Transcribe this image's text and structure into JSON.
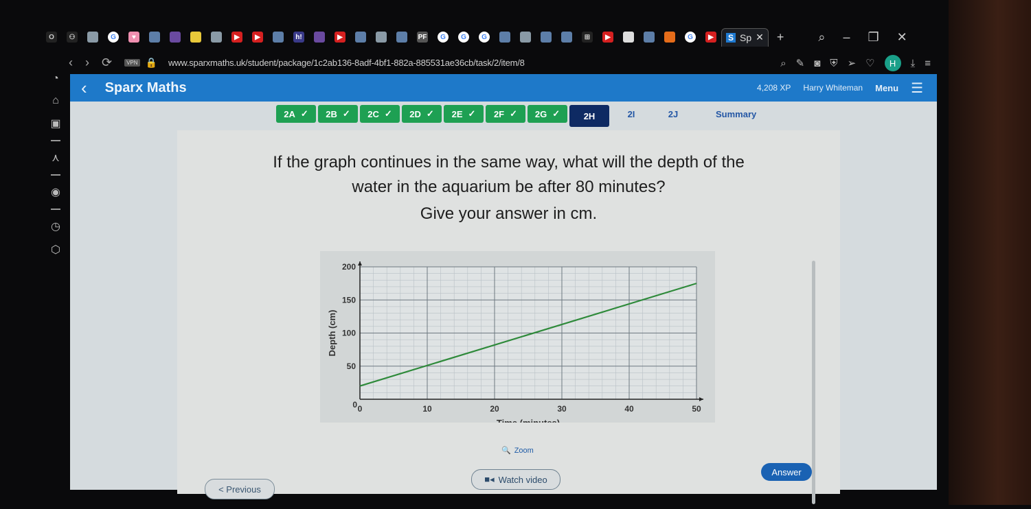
{
  "browser": {
    "tab_title": "Sp",
    "tab_badge": "S",
    "url": "www.sparxmaths.uk/student/package/1c2ab136-8adf-4bf1-882a-885531ae36cb/task/2/item/8",
    "vpn_label": "VPN",
    "profile_initial": "H",
    "tab_icons": [
      "opera-icon",
      "gamepad-icon",
      "roblox-icon",
      "google-icon",
      "heart-icon",
      "app-icon",
      "game-icon",
      "banana-icon",
      "roblox-icon",
      "youtube-icon",
      "youtube-icon",
      "app-icon",
      "hi-icon",
      "game-icon",
      "youtube-icon",
      "app-icon",
      "roblox-icon",
      "app-icon",
      "pf-icon",
      "google-icon",
      "google-icon",
      "google-icon",
      "app-icon",
      "roblox-icon",
      "app-icon",
      "app-icon",
      "grid-icon",
      "youtube-icon",
      "overwatch-icon",
      "app-icon",
      "crunchyroll-icon",
      "google-icon",
      "youtube-icon"
    ]
  },
  "header": {
    "brand": "Sparx Maths",
    "xp": "4,208 XP",
    "user": "Harry Whiteman",
    "menu_label": "Menu"
  },
  "tasks": [
    {
      "label": "2A",
      "state": "done"
    },
    {
      "label": "2B",
      "state": "done"
    },
    {
      "label": "2C",
      "state": "done"
    },
    {
      "label": "2D",
      "state": "done"
    },
    {
      "label": "2E",
      "state": "done"
    },
    {
      "label": "2F",
      "state": "done"
    },
    {
      "label": "2G",
      "state": "done"
    },
    {
      "label": "2H",
      "state": "active"
    },
    {
      "label": "2I",
      "state": "todo"
    },
    {
      "label": "2J",
      "state": "todo"
    },
    {
      "label": "Summary",
      "state": "todo"
    }
  ],
  "question": {
    "line1": "If the graph continues in the same way, what will the depth of the",
    "line2": "water in the aquarium be after 80 minutes?",
    "line3": "Give your answer in cm."
  },
  "chart_data": {
    "type": "line",
    "title": "",
    "xlabel": "Time (minutes)",
    "ylabel": "Depth (cm)",
    "xlim": [
      0,
      50
    ],
    "ylim": [
      0,
      200
    ],
    "x_ticks": [
      0,
      10,
      20,
      30,
      40,
      50
    ],
    "y_ticks": [
      50,
      100,
      150,
      200
    ],
    "grid": true,
    "series": [
      {
        "name": "depth",
        "color": "#2e8a3a",
        "x": [
          0,
          50
        ],
        "y": [
          20,
          175
        ]
      }
    ]
  },
  "controls": {
    "zoom_label": "Zoom",
    "previous_label": "< Previous",
    "watch_video_label": "Watch video",
    "answer_label": "Answer"
  }
}
